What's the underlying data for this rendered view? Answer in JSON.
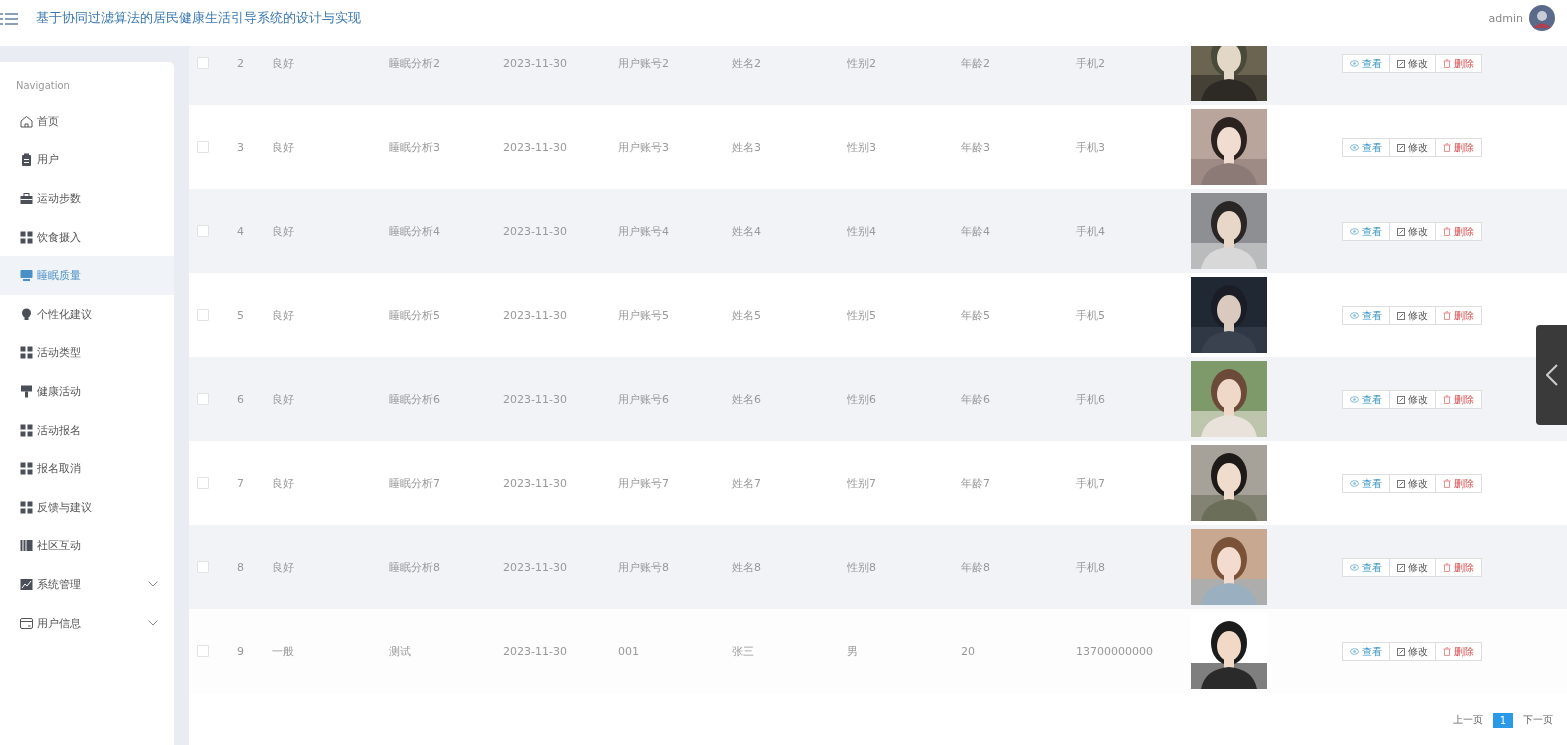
{
  "header": {
    "title": "基于协同过滤算法的居民健康生活引导系统的设计与实现",
    "user": "admin"
  },
  "sidebar": {
    "heading": "Navigation",
    "items": [
      {
        "label": "首页",
        "kind": "item",
        "selected": false
      },
      {
        "label": "用户",
        "kind": "item",
        "selected": false
      },
      {
        "label": "运动步数",
        "kind": "item",
        "selected": false
      },
      {
        "label": "饮食摄入",
        "kind": "item",
        "selected": false
      },
      {
        "label": "睡眠质量",
        "kind": "item",
        "selected": true
      },
      {
        "label": "个性化建议",
        "kind": "item",
        "selected": false
      },
      {
        "label": "活动类型",
        "kind": "item",
        "selected": false
      },
      {
        "label": "健康活动",
        "kind": "item",
        "selected": false
      },
      {
        "label": "活动报名",
        "kind": "item",
        "selected": false
      },
      {
        "label": "报名取消",
        "kind": "item",
        "selected": false
      },
      {
        "label": "反馈与建议",
        "kind": "item",
        "selected": false
      },
      {
        "label": "社区互动",
        "kind": "item",
        "selected": false
      },
      {
        "label": "系统管理",
        "kind": "group",
        "selected": false,
        "expanded": false
      },
      {
        "label": "用户信息",
        "kind": "group",
        "selected": false,
        "expanded": false
      }
    ]
  },
  "table": {
    "rows": [
      {
        "checked": false,
        "index": "2",
        "status": "良好",
        "analysis": "睡眠分析2",
        "date": "2023-11-30",
        "account": "用户账号2",
        "name": "姓名2",
        "gender": "性别2",
        "age": "年龄2",
        "phone": "手机2",
        "actions": [
          "查看",
          "修改",
          "删除"
        ]
      },
      {
        "checked": false,
        "index": "3",
        "status": "良好",
        "analysis": "睡眠分析3",
        "date": "2023-11-30",
        "account": "用户账号3",
        "name": "姓名3",
        "gender": "性别3",
        "age": "年龄3",
        "phone": "手机3",
        "actions": [
          "查看",
          "修改",
          "删除"
        ]
      },
      {
        "checked": false,
        "index": "4",
        "status": "良好",
        "analysis": "睡眠分析4",
        "date": "2023-11-30",
        "account": "用户账号4",
        "name": "姓名4",
        "gender": "性别4",
        "age": "年龄4",
        "phone": "手机4",
        "actions": [
          "查看",
          "修改",
          "删除"
        ]
      },
      {
        "checked": false,
        "index": "5",
        "status": "良好",
        "analysis": "睡眠分析5",
        "date": "2023-11-30",
        "account": "用户账号5",
        "name": "姓名5",
        "gender": "性别5",
        "age": "年龄5",
        "phone": "手机5",
        "actions": [
          "查看",
          "修改",
          "删除"
        ]
      },
      {
        "checked": false,
        "index": "6",
        "status": "良好",
        "analysis": "睡眠分析6",
        "date": "2023-11-30",
        "account": "用户账号6",
        "name": "姓名6",
        "gender": "性别6",
        "age": "年龄6",
        "phone": "手机6",
        "actions": [
          "查看",
          "修改",
          "删除"
        ]
      },
      {
        "checked": false,
        "index": "7",
        "status": "良好",
        "analysis": "睡眠分析7",
        "date": "2023-11-30",
        "account": "用户账号7",
        "name": "姓名7",
        "gender": "性别7",
        "age": "年龄7",
        "phone": "手机7",
        "actions": [
          "查看",
          "修改",
          "删除"
        ]
      },
      {
        "checked": false,
        "index": "8",
        "status": "良好",
        "analysis": "睡眠分析8",
        "date": "2023-11-30",
        "account": "用户账号8",
        "name": "姓名8",
        "gender": "性别8",
        "age": "年龄8",
        "phone": "手机8",
        "actions": [
          "查看",
          "修改",
          "删除"
        ]
      },
      {
        "checked": false,
        "index": "9",
        "status": "一般",
        "analysis": "测试",
        "date": "2023-11-30",
        "account": "001",
        "name": "张三",
        "gender": "男",
        "age": "20",
        "phone": "13700000000",
        "actions": [
          "查看",
          "修改",
          "删除"
        ]
      }
    ]
  },
  "pagination": {
    "prev": "上一页",
    "pages": [
      {
        "label": "1",
        "selected": true
      }
    ],
    "next": "下一页"
  }
}
